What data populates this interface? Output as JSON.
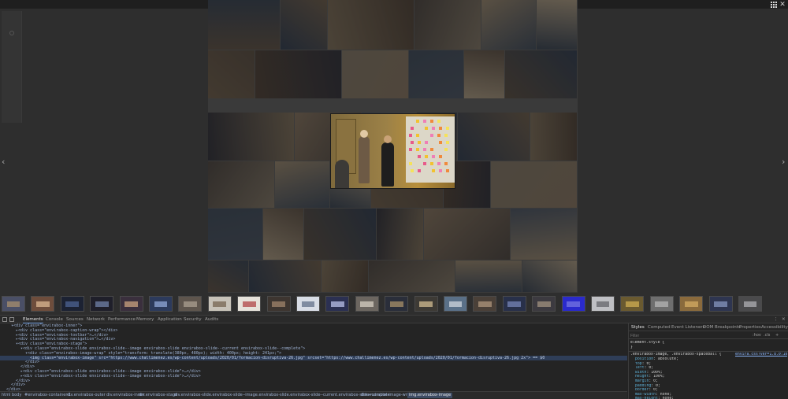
{
  "viewer": {
    "prev_arrow": "‹",
    "next_arrow": "›",
    "close_glyph": "✕",
    "icons": [
      "grid-icon",
      "close-icon",
      "chevron-left-icon",
      "chevron-right-icon"
    ]
  },
  "collage_colors": [
    "#6b5e52",
    "#3e4a5c",
    "#8a7b66",
    "#59524d",
    "#a3927a",
    "#46505e",
    "#7a6a58",
    "#5c4f44",
    "#8d8272",
    "#4c5766",
    "#b5a58d",
    "#665a4e",
    "#3d3d45",
    "#92806c",
    "#57606e"
  ],
  "thumbnails": [
    {
      "a": "#4a4f66",
      "b": "#a08a6e"
    },
    {
      "a": "#6e4d3c",
      "b": "#d4b08c"
    },
    {
      "a": "#1c2233",
      "b": "#4a5f8c"
    },
    {
      "a": "#1f1f2a",
      "b": "#6a7aa0"
    },
    {
      "a": "#3a2f3d",
      "b": "#c09a7a"
    },
    {
      "a": "#2c3a5c",
      "b": "#8aa0d0"
    },
    {
      "a": "#5e554d",
      "b": "#a59a8c"
    },
    {
      "a": "#c7c2b8",
      "b": "#7a6a58"
    },
    {
      "a": "#e6e2da",
      "b": "#b45050"
    },
    {
      "a": "#3d3530",
      "b": "#9a8068"
    },
    {
      "a": "#d8dde6",
      "b": "#6a7890"
    },
    {
      "a": "#2b3052",
      "b": "#b0b8e0"
    },
    {
      "a": "#6c6660",
      "b": "#d0c8bc"
    },
    {
      "a": "#2a2e3a",
      "b": "#a08a66"
    },
    {
      "a": "#3d3a35",
      "b": "#c8b48c"
    },
    {
      "a": "#5a7088",
      "b": "#c8d0d8"
    },
    {
      "a": "#4a4038",
      "b": "#a89078"
    },
    {
      "a": "#28304a",
      "b": "#7080b0"
    },
    {
      "a": "#3c3a40",
      "b": "#9a8c7a"
    },
    {
      "a": "#2a2acc",
      "b": "#7070e0"
    },
    {
      "a": "#bfc0c4",
      "b": "#6a6a70"
    },
    {
      "a": "#6a5a30",
      "b": "#c8a850"
    },
    {
      "a": "#6e6e6e",
      "b": "#b0b0b0"
    },
    {
      "a": "#8a6a3c",
      "b": "#d0a860"
    },
    {
      "a": "#2e3550",
      "b": "#8090b8"
    },
    {
      "a": "#4a4a4c",
      "b": "#a8a8ac"
    }
  ],
  "devtools": {
    "tabs": [
      "Elements",
      "Console",
      "Sources",
      "Network",
      "Performance",
      "Memory",
      "Application",
      "Security",
      "Audits"
    ],
    "code_lines": [
      {
        "indent": 2,
        "text": "▾<div class=\"envirabox-inner\">",
        "hl": false
      },
      {
        "indent": 4,
        "text": "▸<div class=\"envirabox-caption-wrap\"></div>",
        "hl": false
      },
      {
        "indent": 4,
        "text": "▸<div class=\"envirabox-toolbar\">…</div>",
        "hl": false
      },
      {
        "indent": 4,
        "text": "▸<div class=\"envirabox-navigation\">…</div>",
        "hl": false
      },
      {
        "indent": 4,
        "text": "▾<div class=\"envirabox-stage\">",
        "hl": false
      },
      {
        "indent": 6,
        "text": "▾<div class=\"envirabox-slide envirabox-slide--image envirabox-slide envirabox-slide--current envirabox-slide--complete\">",
        "hl": false
      },
      {
        "indent": 8,
        "text": "▾<div class=\"envirabox-image-wrap\" style=\"transform: translate(380px, 480px); width: 400px; height: 241px;\">",
        "hl": false
      },
      {
        "indent": 10,
        "text": "<img class=\"envirabox-image\" src=\"https://www.challimenez.es/wp-content/uploads/2020/01/formacion-disruptiva-26.jpg\" srcset=\"https://www.challimenez.es/wp-content/uploads/2020/01/formacion-disruptiva-26.jpg 2x\"> == $0",
        "hl": true
      },
      {
        "indent": 8,
        "text": "</div>",
        "hl": false
      },
      {
        "indent": 6,
        "text": "</div>",
        "hl": false
      },
      {
        "indent": 6,
        "text": "▸<div class=\"envirabox-slide envirabox-slide--image envirabox-slide\">…</div>",
        "hl": false
      },
      {
        "indent": 6,
        "text": "▸<div class=\"envirabox-slide envirabox-slide--image envirabox-slide\">…</div>",
        "hl": false
      },
      {
        "indent": 4,
        "text": "</div>",
        "hl": false
      },
      {
        "indent": 2,
        "text": "</div>",
        "hl": false
      },
      {
        "indent": 0,
        "text": "</div>",
        "hl": false
      }
    ],
    "style_tabs": [
      "Styles",
      "Computed",
      "Event Listeners",
      "DOM Breakpoints",
      "Properties",
      "Accessibility"
    ],
    "filter_placeholder": "Filter",
    "filter_hov": ":hov",
    "filter_cls": ".cls",
    "filter_plus": "+",
    "element_style": "element.style {",
    "element_style_close": "}",
    "rule_selector": ".envirabox-image, .envirabox-spaceball {",
    "rule_source": "envira.css?ver=1.8.0:1007",
    "rule_props": [
      {
        "p": "position",
        "v": "absolute;"
      },
      {
        "p": "top",
        "v": "0;"
      },
      {
        "p": "left",
        "v": "0;"
      },
      {
        "p": "width",
        "v": "100%;"
      },
      {
        "p": "height",
        "v": "100%;"
      },
      {
        "p": "margin",
        "v": "0;"
      },
      {
        "p": "padding",
        "v": "0;"
      },
      {
        "p": "border",
        "v": "0;"
      },
      {
        "p": "max-width",
        "v": "none;"
      },
      {
        "p": "max-height",
        "v": "none;"
      }
    ],
    "breadcrumbs": [
      "html",
      "body",
      "#envirabox-container-1",
      "div.envirabox-outer",
      "div.envirabox-inner",
      "div.envirabox-stage",
      "div.envirabox-slide.envirabox-slide--image.envirabox-slide.envirabox-slide--current.envirabox-slide--complete",
      "div.envirabox-image-wrap",
      "img.envirabox-image"
    ]
  }
}
